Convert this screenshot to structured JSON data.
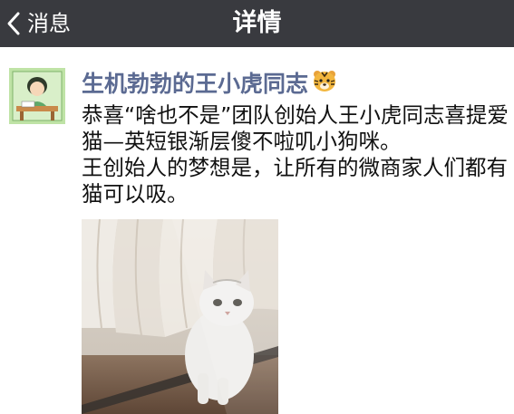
{
  "navbar": {
    "back_label": "消息",
    "title": "详情"
  },
  "post": {
    "author": "生机勃勃的王小虎同志",
    "author_emoji": "tiger-face-emoji",
    "text_lines": [
      "恭喜“啥也不是”团队创始人王小虎同志喜提爱猫—英短银渐层傻不啦叽小狗咪。",
      "王创始人的梦想是，让所有的微商家人们都有猫可以吸。"
    ],
    "image": "cat-behind-glass-photo"
  },
  "colors": {
    "navbar_bg": "#393a3f",
    "author_name": "#5b6a92",
    "text": "#111111"
  }
}
